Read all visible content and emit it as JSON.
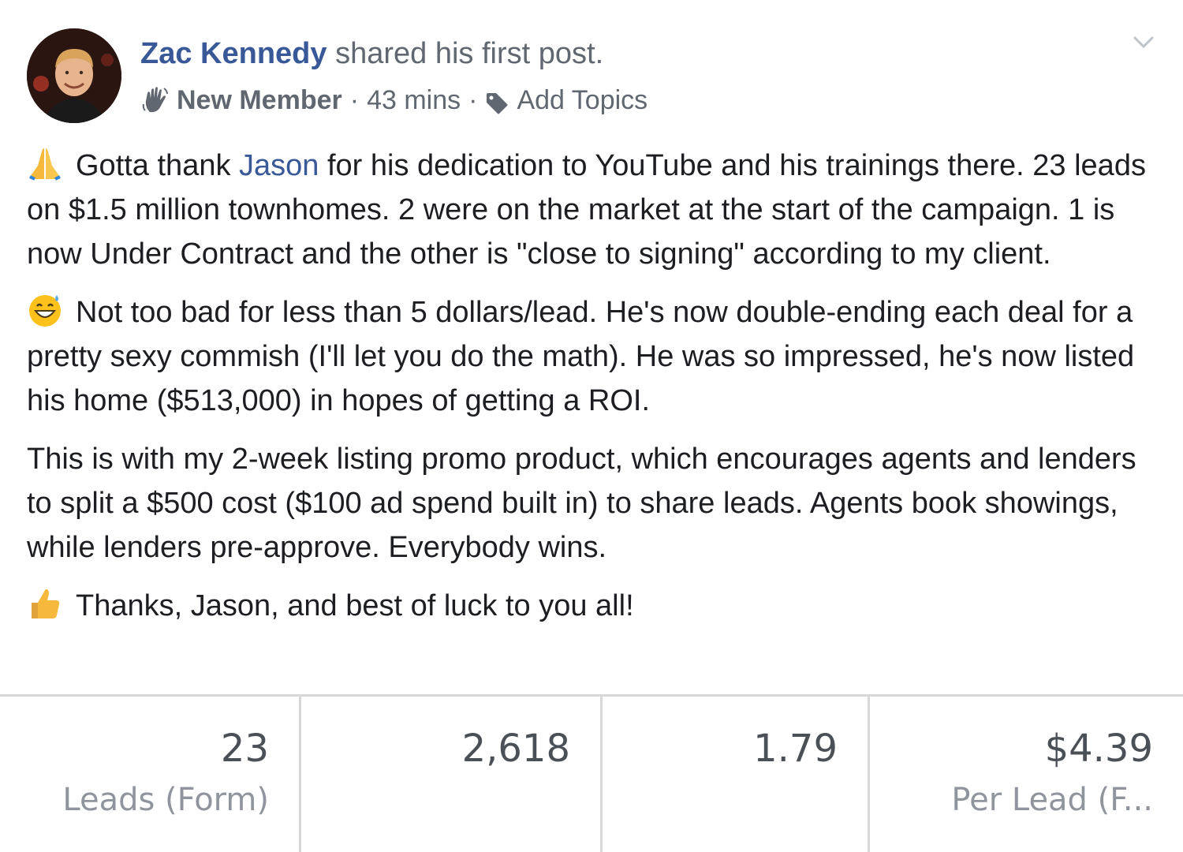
{
  "post": {
    "author": "Zac Kennedy",
    "action": "shared his first post.",
    "badge": "New Member",
    "separator": "·",
    "time": "43 mins",
    "topics": "Add Topics"
  },
  "body": {
    "p1_a": "Gotta thank ",
    "p1_mention": "Jason",
    "p1_b": " for his dedication to YouTube and his trainings there. 23 leads on $1.5 million townhomes. 2 were on the market at the start of the campaign. 1 is now Under Contract and the other is \"close to signing\" according to my client.",
    "p2": "Not too bad for less than 5 dollars/lead. He's now double-ending each deal for a pretty sexy commish (I'll let you do the math). He was so impressed, he's now listed his home ($513,000) in hopes of getting a ROI.",
    "p3": "This is with my 2-week listing promo product, which encourages agents and lenders to split a $500 cost ($100 ad spend built in) to share leads. Agents book showings, while lenders pre-approve. Everybody wins.",
    "p4": "Thanks, Jason, and best of luck to you all!"
  },
  "stats": [
    {
      "value": "23",
      "label": "Leads (Form)"
    },
    {
      "value": "2,618",
      "label": ""
    },
    {
      "value": "1.79",
      "label": ""
    },
    {
      "value": "$4.39",
      "label": "Per Lead (F..."
    }
  ],
  "colors": {
    "link": "#385898",
    "meta": "#606770",
    "text": "#1c1e21",
    "divider": "#d8d8d8"
  },
  "icons": {
    "avatar": "profile-photo",
    "badge": "waving-hand-icon",
    "topics": "tag-icon",
    "menu": "chevron-down-icon",
    "p1": "folded-hands-emoji",
    "p2": "grinning-sweat-emoji",
    "p4": "thumbs-up-emoji"
  }
}
